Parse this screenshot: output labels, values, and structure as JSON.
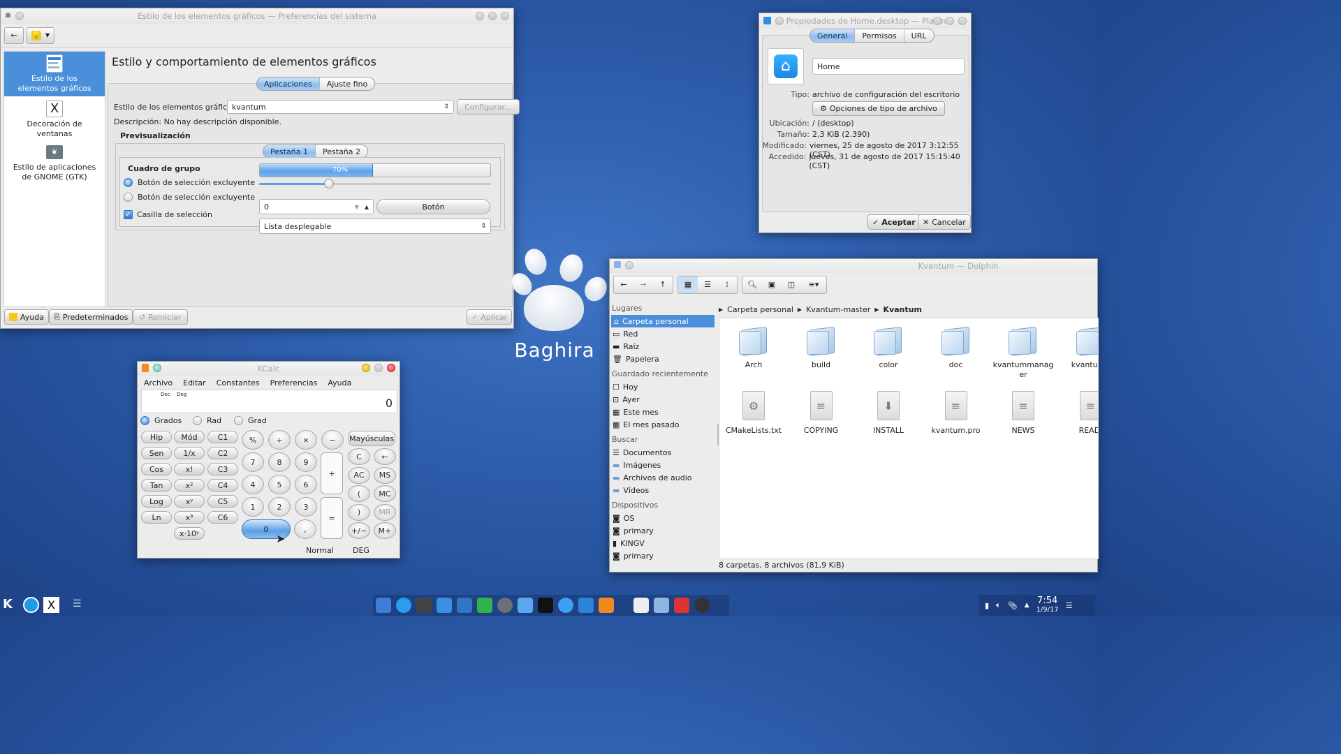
{
  "settings": {
    "title": "Estilo de los elementos gráficos — Preferencias del sistema",
    "heading": "Estilo y comportamiento de elementos gráficos",
    "sidebar": [
      {
        "label": "Estilo de los elementos gráficos",
        "icon": "widget-style-icon"
      },
      {
        "label": "Decoración de ventanas",
        "icon": "x-window-icon"
      },
      {
        "label": "Estilo de aplicaciones de GNOME (GTK)",
        "icon": "gnome-icon"
      }
    ],
    "tabs": [
      "Aplicaciones",
      "Ajuste fino"
    ],
    "style_label": "Estilo de los elementos gráficos:",
    "style_value": "kvantum",
    "configure": "Configurar...",
    "description": "Descripción: No hay descripción disponible.",
    "preview": "Previsualización",
    "preview_tabs": [
      "Pestaña 1",
      "Pestaña 2"
    ],
    "group_box": "Cuadro de grupo",
    "radio1": "Botón de selección excluyente",
    "radio2": "Botón de selección excluyente",
    "checkbox": "Casilla de selección",
    "progress_value": 0.7,
    "progress_label": "70%",
    "slider_value": 0.3,
    "spin_value": "0",
    "button": "Botón",
    "dropdown": "Lista desplegable",
    "help": "Ayuda",
    "defaults": "Predeterminados",
    "reset": "Reiniciar",
    "apply": "Aplicar"
  },
  "props": {
    "title": "Propiedades de Home.desktop — Plasma",
    "tabs": [
      "General",
      "Permisos",
      "URL"
    ],
    "name": "Home",
    "rows": [
      {
        "k": "Tipo:",
        "v": "archivo de configuración del escritorio"
      },
      {
        "k": "Ubicación:",
        "v": "/ (desktop)"
      },
      {
        "k": "Tamaño:",
        "v": "2,3 KiB (2.390)"
      },
      {
        "k": "Modificado:",
        "v": "viernes, 25 de agosto de 2017 3:12:55 (CST)"
      },
      {
        "k": "Accedido:",
        "v": "jueves, 31 de agosto de 2017 15:15:40 (CST)"
      }
    ],
    "filetype_btn": "Opciones de tipo de archivo",
    "ok": "Aceptar",
    "cancel": "Cancelar"
  },
  "logo_text": "Baghira",
  "kcalc": {
    "title": "KCalc",
    "menu": [
      "Archivo",
      "Editar",
      "Constantes",
      "Preferencias",
      "Ayuda"
    ],
    "display_tags": [
      "Dec",
      "Deg"
    ],
    "display_value": "0",
    "angle_modes": [
      "Grados",
      "Rad",
      "Grad"
    ],
    "col1": [
      "Hip",
      "Sen",
      "Cos",
      "Tan",
      "Log",
      "Ln"
    ],
    "col2": [
      "Mód",
      "1/x",
      "x!",
      "x²",
      "xʸ",
      "x³",
      "x·10ʸ"
    ],
    "col3": [
      "C1",
      "C2",
      "C3",
      "C4",
      "C5",
      "C6"
    ],
    "ops": [
      "%",
      "÷",
      "×",
      "−"
    ],
    "digits": [
      "7",
      "8",
      "9",
      "4",
      "5",
      "6",
      "1",
      "2",
      "3"
    ],
    "zero": "0",
    "comma": ",",
    "plus": "+",
    "equals": "=",
    "shift": "Mayúsculas",
    "right_col1": [
      "C",
      "AC",
      "(",
      ")",
      "+/−"
    ],
    "right_col2": [
      "←",
      "MS",
      "MC",
      "MR",
      "M+"
    ],
    "status": [
      "Normal",
      "DEG"
    ]
  },
  "dolphin": {
    "title": "Kvantum — Dolphin",
    "places_head": "Lugares",
    "places": [
      "Carpeta personal",
      "Red",
      "Raíz",
      "Papelera"
    ],
    "recent_head": "Guardado recientemente",
    "recent": [
      "Hoy",
      "Ayer",
      "Este mes",
      "El mes pasado"
    ],
    "search_head": "Buscar",
    "search": [
      "Documentos",
      "Imágenes",
      "Archivos de audio",
      "Vídeos"
    ],
    "devices_head": "Dispositivos",
    "devices": [
      "OS",
      "primary",
      "KINGV",
      "primary"
    ],
    "breadcrumb": [
      "Carpeta personal",
      "Kvantum-master",
      "Kvantum"
    ],
    "folders": [
      "Arch",
      "build",
      "color",
      "doc",
      "kvantummanager",
      "kvantump"
    ],
    "files": [
      "CMakeLists.txt",
      "COPYING",
      "INSTALL",
      "kvantum.pro",
      "NEWS",
      "READI"
    ],
    "status": "8 carpetas, 8 archivos (81,9 KiB)"
  },
  "taskbar": {
    "time": "7:54",
    "date": "1/9/17"
  }
}
